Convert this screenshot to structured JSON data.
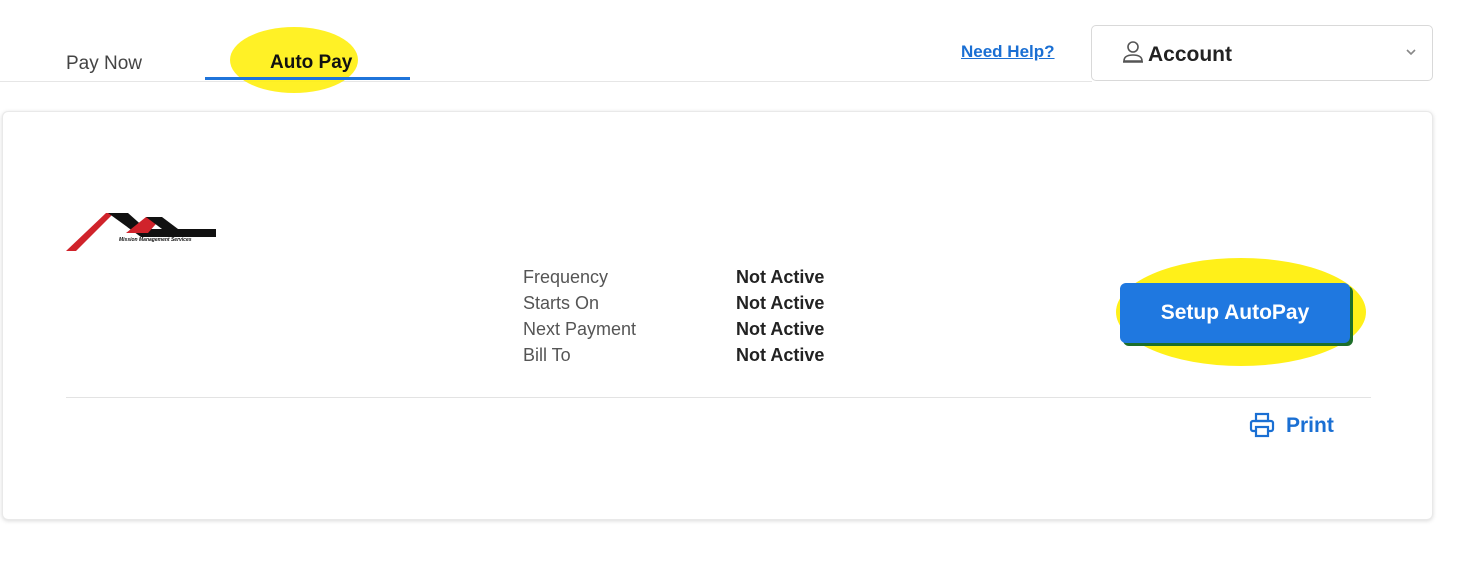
{
  "tabs": [
    {
      "label": "Pay Now",
      "active": false
    },
    {
      "label": "Auto Pay",
      "active": true
    }
  ],
  "header": {
    "need_help": "Need Help?",
    "account_label": "Account"
  },
  "logo": {
    "company": "Mission Management Services"
  },
  "autopay_info": [
    {
      "label": "Frequency",
      "value": "Not Active"
    },
    {
      "label": "Starts On",
      "value": "Not Active"
    },
    {
      "label": "Next Payment",
      "value": "Not Active"
    },
    {
      "label": "Bill To",
      "value": "Not Active"
    }
  ],
  "actions": {
    "setup_label": "Setup AutoPay",
    "print_label": "Print"
  },
  "colors": {
    "accent": "#1f78e0",
    "link": "#1a6fd3",
    "highlight": "#ffee00",
    "logo_red": "#d0232b"
  },
  "icons": [
    "user-icon",
    "chevron-down-icon",
    "printer-icon"
  ]
}
